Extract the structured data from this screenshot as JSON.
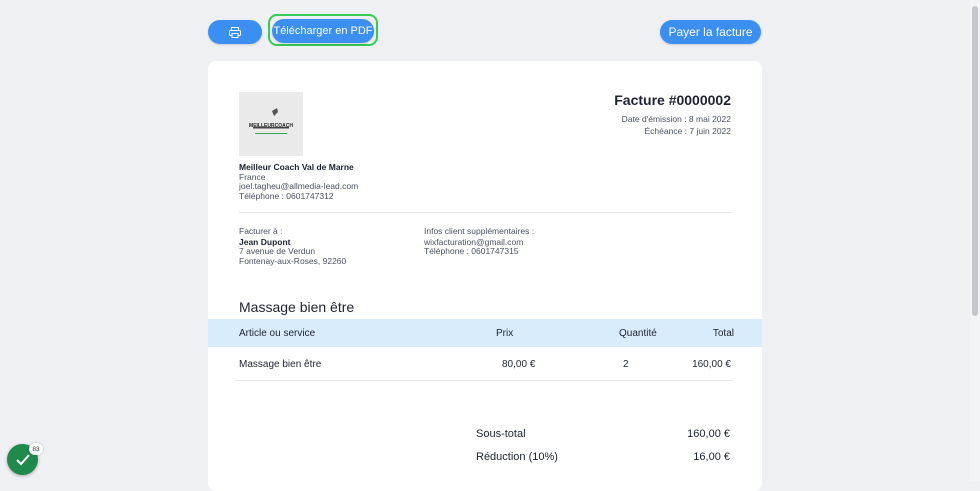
{
  "toolbar": {
    "print_icon": "printer-icon",
    "download_label": "Télécharger en PDF",
    "pay_label": "Payer la facture",
    "accent": "#3b8ff0",
    "focus_color": "#33cc55"
  },
  "invoice": {
    "title": "Facture #0000002",
    "issue_date": "Date d'émission : 8 mai 2022",
    "due_date": "Échéance : 7 juin 2022",
    "logo_text": "MEILLEURCOACH",
    "company": {
      "name": "Meilleur Coach Val de Marne",
      "country": "France",
      "email": "joel.tagheu@allmedia-lead.com",
      "phone": "Téléphone : 0601747312"
    },
    "bill_to": {
      "heading": "Facturer à :",
      "name": "Jean Dupont",
      "address1": "7 avenue de Verdun",
      "address2": "Fontenay-aux-Roses, 92260"
    },
    "client_info": {
      "heading": "Infos client supplémentaires :",
      "email": "wixfacturation@gmail.com",
      "phone": "Téléphone : 0601747315"
    },
    "section_title": "Massage bien être",
    "table": {
      "headers": [
        "Article ou service",
        "Prix",
        "Quantité",
        "Total"
      ],
      "rows": [
        [
          "Massage bien être",
          "80,00 €",
          "2",
          "160,00 €"
        ]
      ]
    },
    "totals": {
      "subtotal_label": "Sous-total",
      "subtotal_value": "160,00 €",
      "discount_label": "Réduction (10%)",
      "discount_value": "16,00 €"
    }
  },
  "badge": {
    "count": "83",
    "color": "#1f8a4c"
  }
}
